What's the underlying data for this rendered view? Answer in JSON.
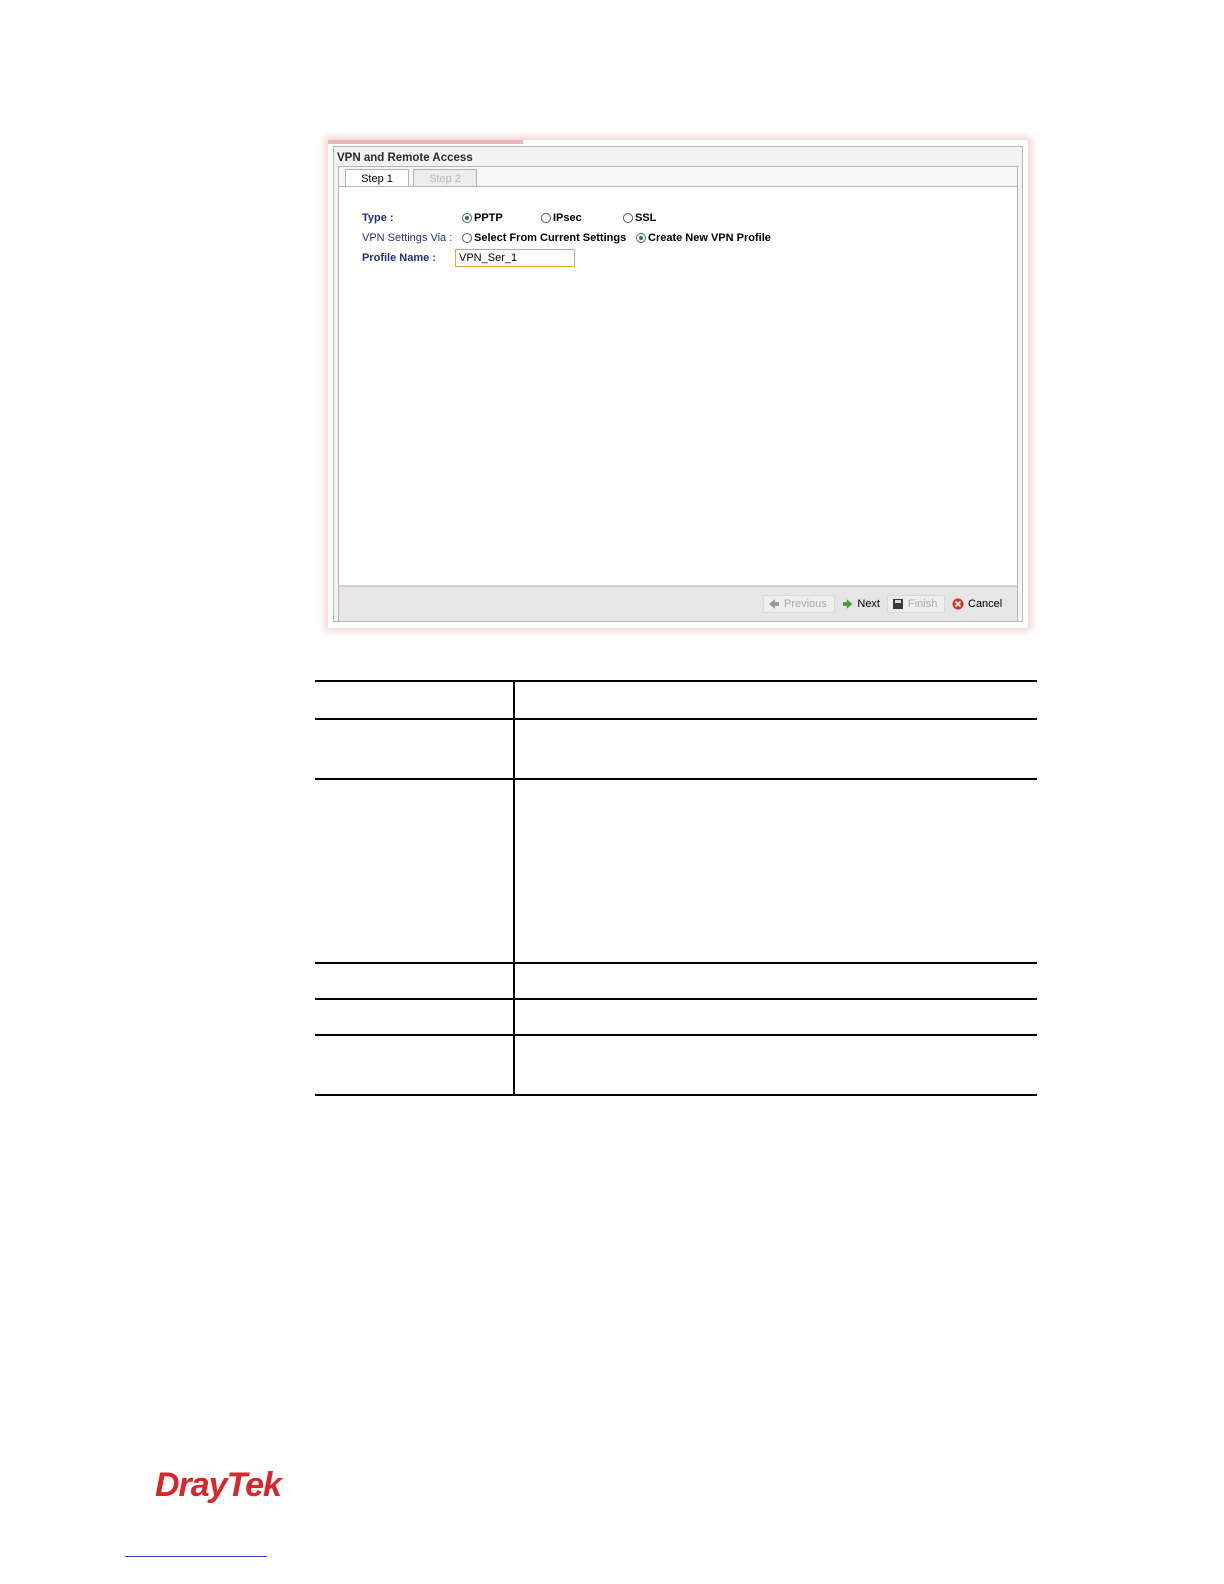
{
  "window": {
    "title": "VPN and Remote Access"
  },
  "tabs": [
    {
      "label": "Step 1",
      "active": true
    },
    {
      "label": "Step 2",
      "active": false
    }
  ],
  "form": {
    "type_label": "Type :",
    "type_options": [
      {
        "label": "PPTP",
        "checked": true
      },
      {
        "label": "IPsec",
        "checked": false
      },
      {
        "label": "SSL",
        "checked": false
      }
    ],
    "settings_label": "VPN Settings Via :",
    "settings_options": [
      {
        "label": "Select From Current Settings",
        "checked": false
      },
      {
        "label": "Create New VPN Profile",
        "checked": true
      }
    ],
    "profile_label": "Profile Name :",
    "profile_value": "VPN_Ser_1"
  },
  "buttons": {
    "previous": "Previous",
    "next": "Next",
    "finish": "Finish",
    "cancel": "Cancel"
  },
  "brand": {
    "name": "DrayTek"
  }
}
